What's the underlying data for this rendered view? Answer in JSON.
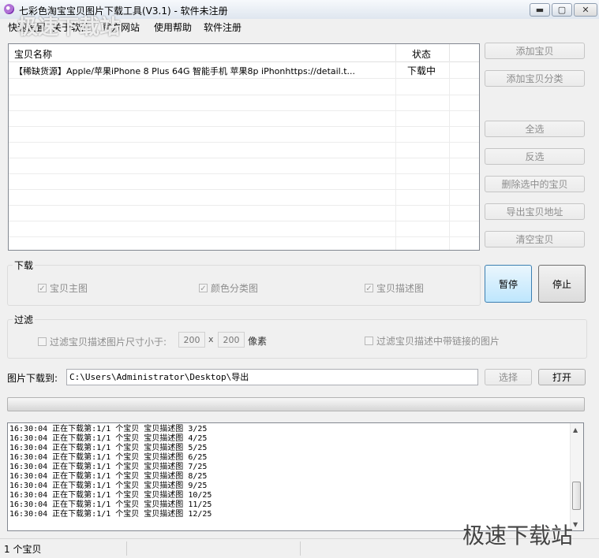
{
  "window": {
    "title": "七彩色淘宝宝贝图片下载工具(V3.1) - 软件未注册",
    "min_glyph": "▬",
    "max_glyph": "▢",
    "close_glyph": "✕",
    "icon": "app-icon"
  },
  "menu": [
    {
      "label": "快速设置"
    },
    {
      "label": "关于软件"
    },
    {
      "label": "官方网站"
    },
    {
      "label": "使用帮助"
    },
    {
      "label": "软件注册"
    }
  ],
  "list": {
    "columns": [
      "宝贝名称",
      "状态"
    ],
    "rows": [
      {
        "name": "【稀缺货源】Apple/苹果iPhone 8 Plus 64G 智能手机 苹果8p iPhonhttps://detail.t...",
        "status": "下载中"
      }
    ]
  },
  "side_buttons": {
    "add_item": "添加宝贝",
    "add_category": "添加宝贝分类",
    "select_all": "全选",
    "invert": "反选",
    "delete_selected": "删除选中的宝贝",
    "export_urls": "导出宝贝地址",
    "clear_items": "清空宝贝"
  },
  "download": {
    "group_label": "下载",
    "main_images": "宝贝主图",
    "color_images": "颜色分类图",
    "desc_images": "宝贝描述图",
    "pause": "暂停",
    "stop": "停止"
  },
  "filter": {
    "group_label": "过滤",
    "size_label": "过滤宝贝描述图片尺寸小于:",
    "width": "200",
    "times": "x",
    "height": "200",
    "unit": "像素",
    "link_label": "过滤宝贝描述中带链接的图片"
  },
  "save": {
    "label": "图片下载到:",
    "path": "C:\\Users\\Administrator\\Desktop\\导出",
    "choose": "选择",
    "open": "打开"
  },
  "log": [
    "16:30:04 正在下载第:1/1 个宝贝 宝贝描述图 3/25",
    "16:30:04 正在下载第:1/1 个宝贝 宝贝描述图 4/25",
    "16:30:04 正在下载第:1/1 个宝贝 宝贝描述图 5/25",
    "16:30:04 正在下载第:1/1 个宝贝 宝贝描述图 6/25",
    "16:30:04 正在下载第:1/1 个宝贝 宝贝描述图 7/25",
    "16:30:04 正在下载第:1/1 个宝贝 宝贝描述图 8/25",
    "16:30:04 正在下载第:1/1 个宝贝 宝贝描述图 9/25",
    "16:30:04 正在下载第:1/1 个宝贝 宝贝描述图 10/25",
    "16:30:04 正在下载第:1/1 个宝贝 宝贝描述图 11/25",
    "16:30:04 正在下载第:1/1 个宝贝 宝贝描述图 12/25"
  ],
  "status": {
    "count": "1 个宝贝"
  },
  "watermark": {
    "top": "极速下载站",
    "bottom": "极速下载站"
  }
}
